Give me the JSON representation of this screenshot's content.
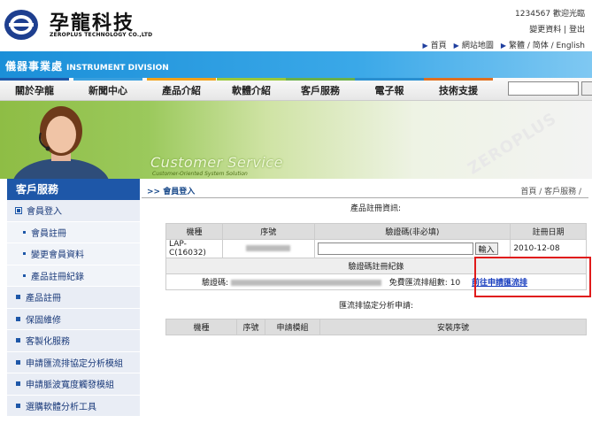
{
  "header": {
    "logo_cn": "孕龍科技",
    "logo_en": "ZEROPLUS TECHNOLOGY CO.,LTD",
    "user_greeting": "1234567 歡迎光臨",
    "user_links": [
      "變更資料",
      "登出"
    ],
    "top_links": [
      "首頁",
      "網站地圖",
      "繁體 / 简体 / English"
    ]
  },
  "banner": {
    "title_cn": "儀器事業處",
    "title_en": "INSTRUMENT DIVISION"
  },
  "nav": {
    "items": [
      "關於孕龍",
      "新聞中心",
      "產品介紹",
      "軟體介紹",
      "客戶服務",
      "電子報",
      "技術支援"
    ],
    "bar_colors": [
      "#1e57a8",
      "#3aa0de",
      "#f2a21a",
      "#9bc83a",
      "#6bb04a",
      "#2a8fd0",
      "#e07020"
    ]
  },
  "hero": {
    "title": "Customer Service",
    "subtitle": "Customer-Oriented System Solution",
    "brand": "ZEROPLUS"
  },
  "sidebar": {
    "title": "客戶服務",
    "items": [
      {
        "label": "會員登入",
        "level": 0
      },
      {
        "label": "會員註冊",
        "level": 1
      },
      {
        "label": "變更會員資料",
        "level": 1
      },
      {
        "label": "產品註冊紀錄",
        "level": 1
      },
      {
        "label": "產品註冊",
        "level": 0
      },
      {
        "label": "保固維修",
        "level": 0
      },
      {
        "label": "客製化服務",
        "level": 0
      },
      {
        "label": "申請匯流排協定分析模組",
        "level": 0
      },
      {
        "label": "申請脈波寬度觸發模組",
        "level": 0
      },
      {
        "label": "選購軟體分析工具",
        "level": 0
      }
    ]
  },
  "content": {
    "crumb_left": ">> 會員登入",
    "crumb_right": "首頁 / 客戶服務 /",
    "reg_title": "產品註冊資訊:",
    "reg_headers": [
      "機種",
      "序號",
      "驗證碼(非必填)",
      "註冊日期"
    ],
    "reg_row": {
      "model": "LAP-C(16032)",
      "date": "2010-12-08"
    },
    "enter_label": "輸入",
    "record_title": "驗證碼註冊紀錄",
    "code_label": "驗證碼:",
    "free_label": "免費匯流排組數:",
    "free_count": "10",
    "apply_link": "前往申請匯流排",
    "bus_title": "匯流排協定分析申請:",
    "bus_headers": [
      "機種",
      "序號",
      "申請模組",
      "安裝序號"
    ]
  }
}
